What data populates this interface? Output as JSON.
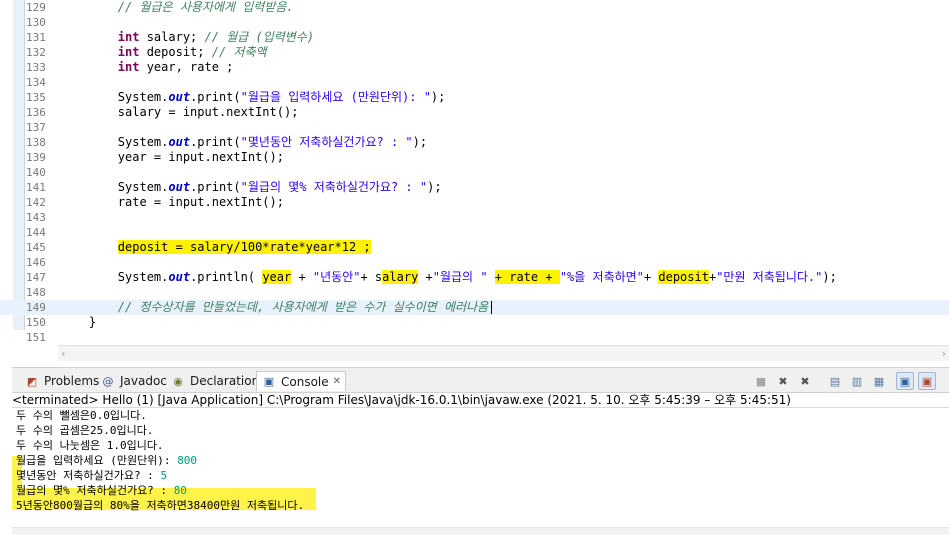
{
  "editor": {
    "lines": [
      {
        "n": "129",
        "parts": [
          {
            "t": "        "
          },
          {
            "t": "// 월급은 사용자에게 입력받음.",
            "c": "cm"
          }
        ]
      },
      {
        "n": "130",
        "parts": []
      },
      {
        "n": "131",
        "parts": [
          {
            "t": "        "
          },
          {
            "t": "int",
            "c": "kw"
          },
          {
            "t": " salary; "
          },
          {
            "t": "// 월급 (입력변수)",
            "c": "cm"
          }
        ]
      },
      {
        "n": "132",
        "parts": [
          {
            "t": "        "
          },
          {
            "t": "int",
            "c": "kw"
          },
          {
            "t": " deposit; "
          },
          {
            "t": "// 저축액",
            "c": "cm"
          }
        ]
      },
      {
        "n": "133",
        "parts": [
          {
            "t": "        "
          },
          {
            "t": "int",
            "c": "kw"
          },
          {
            "t": " year, rate ;"
          }
        ]
      },
      {
        "n": "134",
        "parts": []
      },
      {
        "n": "135",
        "parts": [
          {
            "t": "        System."
          },
          {
            "t": "out",
            "c": "fld"
          },
          {
            "t": ".print("
          },
          {
            "t": "\"월급을 입력하세요 (만원단위): \"",
            "c": "st"
          },
          {
            "t": ");"
          }
        ]
      },
      {
        "n": "136",
        "parts": [
          {
            "t": "        salary = input.nextInt();"
          }
        ]
      },
      {
        "n": "137",
        "parts": []
      },
      {
        "n": "138",
        "parts": [
          {
            "t": "        System."
          },
          {
            "t": "out",
            "c": "fld"
          },
          {
            "t": ".print("
          },
          {
            "t": "\"몇년동안 저축하실건가요? : \"",
            "c": "st"
          },
          {
            "t": ");"
          }
        ]
      },
      {
        "n": "139",
        "parts": [
          {
            "t": "        year = input.nextInt();"
          }
        ]
      },
      {
        "n": "140",
        "parts": []
      },
      {
        "n": "141",
        "parts": [
          {
            "t": "        System."
          },
          {
            "t": "out",
            "c": "fld"
          },
          {
            "t": ".print("
          },
          {
            "t": "\"월급의 몇% 저축하실건가요? : \"",
            "c": "st"
          },
          {
            "t": ");"
          }
        ]
      },
      {
        "n": "142",
        "parts": [
          {
            "t": "        rate = input.nextInt();"
          }
        ]
      },
      {
        "n": "143",
        "parts": []
      },
      {
        "n": "144",
        "parts": []
      },
      {
        "n": "145",
        "parts": [
          {
            "t": "        "
          },
          {
            "t": "deposit = salary/100*rate*year*12 ;",
            "c": "hl"
          }
        ]
      },
      {
        "n": "146",
        "parts": []
      },
      {
        "n": "147",
        "parts": [
          {
            "t": "        System."
          },
          {
            "t": "out",
            "c": "fld"
          },
          {
            "t": ".println( "
          },
          {
            "t": "year",
            "c": "hl"
          },
          {
            "t": " + "
          },
          {
            "t": "\"년동안\"",
            "c": "st"
          },
          {
            "t": "+ s"
          },
          {
            "t": "alary",
            "c": "hl"
          },
          {
            "t": " +"
          },
          {
            "t": "\"월급의 \"",
            "c": "st"
          },
          {
            "t": " "
          },
          {
            "t": "+ rate + ",
            "c": "hl"
          },
          {
            "t": "\"%을 저축하면\"",
            "c": "st"
          },
          {
            "t": "+ "
          },
          {
            "t": "deposit",
            "c": "hl"
          },
          {
            "t": "+"
          },
          {
            "t": "\"만원 저축됩니다.\"",
            "c": "st"
          },
          {
            "t": ");"
          }
        ]
      },
      {
        "n": "148",
        "parts": []
      },
      {
        "n": "149",
        "current": true,
        "parts": [
          {
            "t": "        "
          },
          {
            "t": "// 정수상자를 만들었는데, 사용자에게 받은 수가 실수이면 에러나옴",
            "c": "cm"
          }
        ]
      },
      {
        "n": "150",
        "parts": [
          {
            "t": "    }"
          }
        ]
      },
      {
        "n": "151",
        "parts": []
      }
    ]
  },
  "views": {
    "tabs": [
      {
        "name": "tab-problems",
        "icon_name": "problems-icon",
        "icon": "◩",
        "icon_color": "#b0452e",
        "label": "Problems"
      },
      {
        "name": "tab-javadoc",
        "icon_name": "javadoc-icon",
        "icon": "@",
        "icon_color": "#3a5a8c",
        "label": "Javadoc"
      },
      {
        "name": "tab-declaration",
        "icon_name": "declaration-icon",
        "icon": "◉",
        "icon_color": "#6a7f2a",
        "label": "Declaration"
      },
      {
        "name": "tab-console",
        "icon_name": "console-icon",
        "icon": "▣",
        "icon_color": "#2f5f9c",
        "label": "Console",
        "active": true
      }
    ]
  },
  "console": {
    "header": "<terminated> Hello (1) [Java Application] C:\\Program Files\\Java\\jdk-16.0.1\\bin\\javaw.exe  (2021. 5. 10. 오후 5:45:39 – 오후 5:45:51)",
    "lines": [
      {
        "parts": [
          {
            "t": "두 수의 뺄셈은0.0입니다."
          }
        ]
      },
      {
        "parts": [
          {
            "t": "두 수의 곱셈은25.0입니다."
          }
        ]
      },
      {
        "parts": [
          {
            "t": "두 수의 나눗셈은 1.0입니다."
          }
        ]
      },
      {
        "parts": [
          {
            "t": "월급을 입력하세요 (만원단위): "
          },
          {
            "t": "800",
            "c": "cin"
          }
        ]
      },
      {
        "parts": [
          {
            "t": "몇년동안 저축하실건가요? : "
          },
          {
            "t": "5",
            "c": "cin"
          }
        ]
      },
      {
        "parts": [
          {
            "t": "월급의 몇% 저축하실건가요? : "
          },
          {
            "t": "80",
            "c": "cin"
          }
        ]
      },
      {
        "parts": [
          {
            "t": "5년동안800월급의 80%을 저축하면38400만원 저축됩니다."
          }
        ]
      }
    ]
  },
  "colors": {
    "highlight": "#fff200",
    "keyword": "#7f0055",
    "comment": "#3f7f5f",
    "string": "#2a00ff",
    "console_input": "#009a7a"
  }
}
